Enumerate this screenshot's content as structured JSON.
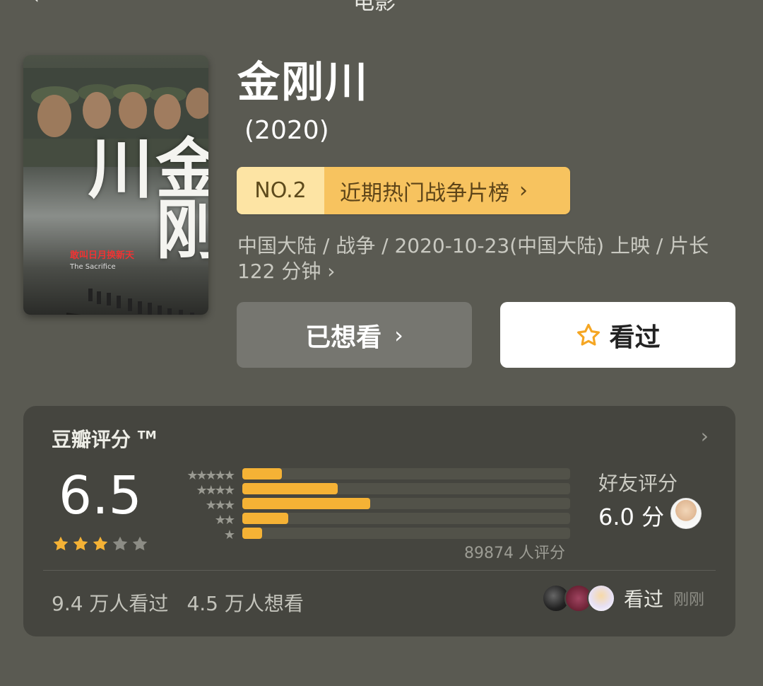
{
  "nav": {
    "back_icon": "chevron-left-icon",
    "title": "电影"
  },
  "poster": {
    "title_art": "金刚川",
    "subtitle_art": "敢叫日月换新天",
    "english_title_art": "The Sacrifice"
  },
  "movie": {
    "title": "金刚川",
    "year": "(2020)",
    "rank_no": "NO.2",
    "rank_list": "近期热门战争片榜",
    "meta_line1": "中国大陆 / 战争 / 2020-10-23(中国大陆) 上映 / 片长",
    "meta_line2": "122 分钟"
  },
  "actions": {
    "wanted_label": "已想看",
    "watched_label": "看过"
  },
  "rating": {
    "title": "豆瓣评分",
    "trademark": "TM",
    "score": "6.5",
    "stars": 3,
    "count_text": "89874 人评分",
    "distribution": [
      {
        "stars": 5,
        "fraction": 0.12
      },
      {
        "stars": 4,
        "fraction": 0.29
      },
      {
        "stars": 3,
        "fraction": 0.39
      },
      {
        "stars": 2,
        "fraction": 0.14
      },
      {
        "stars": 1,
        "fraction": 0.06
      }
    ],
    "friends_label": "好友评分",
    "friends_score": "6.0 分",
    "watched_count": "9.4 万人看过",
    "wanted_count": "4.5 万人想看",
    "friend_activity": "看过",
    "friend_time": "刚刚"
  },
  "colors": {
    "accent": "#f5b235",
    "rank_no_bg": "#fde4a4",
    "rank_list_bg": "#f7c35f",
    "background": "#5a5a52",
    "card": "#45453f"
  }
}
